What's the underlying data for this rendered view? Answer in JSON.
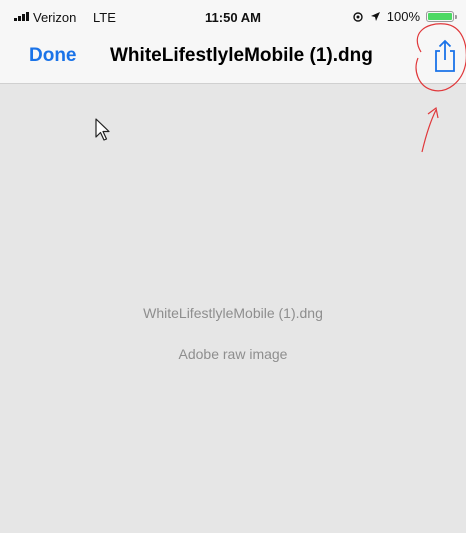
{
  "status_bar": {
    "carrier": "Verizon",
    "network": "LTE",
    "time": "11:50 AM",
    "battery": "100%",
    "battery_level": 1.0
  },
  "nav": {
    "done_label": "Done",
    "title": "WhiteLifestlyleMobile (1).dng",
    "share_icon": "share-icon"
  },
  "preview": {
    "filename": "WhiteLifestlyleMobile (1).dng",
    "file_type": "Adobe raw image"
  },
  "colors": {
    "accent": "#1a73e8",
    "annotation": "#e0383b",
    "battery": "#4cd964",
    "background": "#e6e6e6"
  }
}
